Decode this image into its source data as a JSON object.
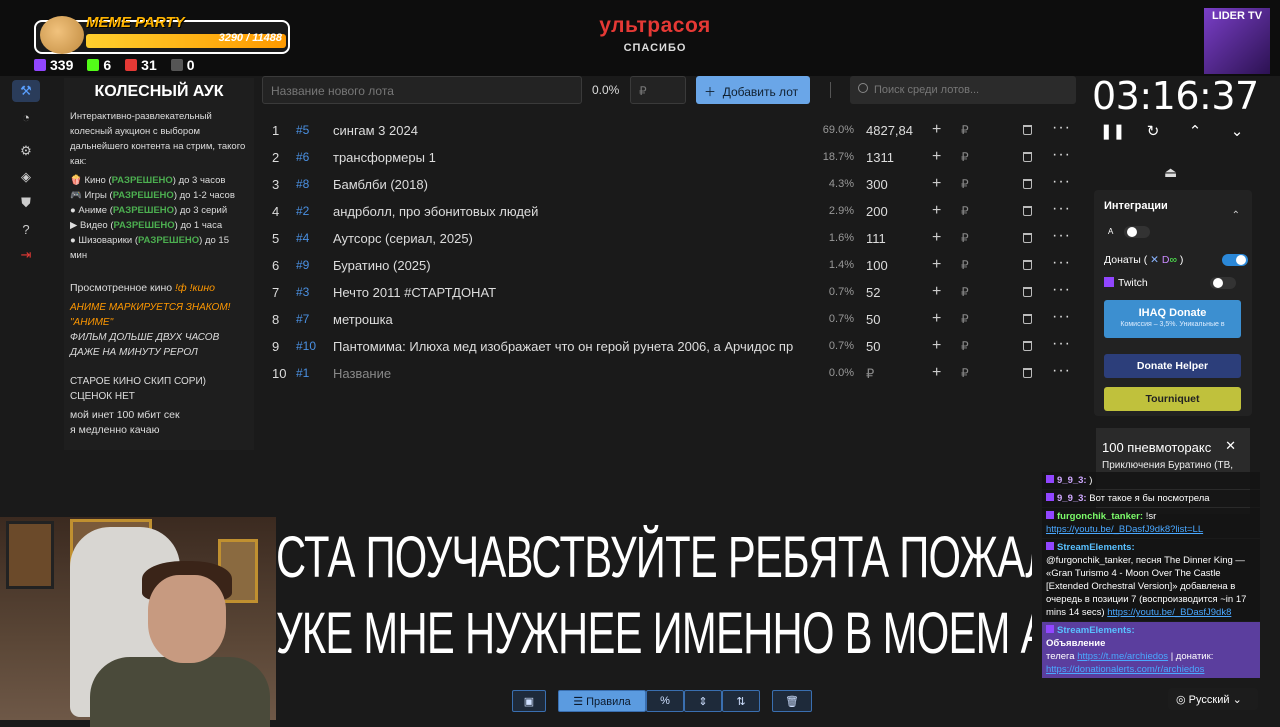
{
  "header": {
    "meme_party": {
      "title": "MEME PARTY",
      "score": "3290 / 11488"
    },
    "stats": [
      {
        "icon": "twitch-icon",
        "value": "339",
        "color": "#9146ff"
      },
      {
        "icon": "kick-icon",
        "value": "6",
        "color": "#53fc18"
      },
      {
        "icon": "vk-live-icon",
        "value": "31",
        "color": "#e53935"
      },
      {
        "icon": "w-icon",
        "value": "0",
        "color": "#ffffff"
      }
    ],
    "brand": {
      "line1": "ультрасоя",
      "line2": "СПАСИБО"
    },
    "channel_badge": "LIDER TV"
  },
  "info_panel": {
    "title": "КОЛЕСНЫЙ АУК",
    "intro": "Интерактивно-развлекательный колесный аукцион с выбором дальнейшего контента на стрим, такого как:",
    "rules": [
      {
        "a": "Кино (",
        "b": "РАЗРЕШЕНО",
        "c": ") до 3 часов"
      },
      {
        "a": "Игры (",
        "b": "РАЗРЕШЕНО",
        "c": ") до 1-2 часов"
      },
      {
        "a": "Аниме (",
        "b": "РАЗРЕШЕНО",
        "c": ") до 3 серий"
      },
      {
        "a": "Видео (",
        "b": "РАЗРЕШЕНО",
        "c": ") до 1 часа"
      },
      {
        "a": "Шизоварики (",
        "b": "РАЗРЕШЕНО",
        "c": ") до 15 мин"
      }
    ],
    "watched": "Просмотренное кино",
    "watched_cmd": "!ф !кино",
    "anime_note": "АНИМЕ МАРКИРУЕТСЯ ЗНАКОМ! \"АНИМЕ\"",
    "film_note": "ФИЛЬМ ДОЛЬШЕ ДВУХ ЧАСОВ ДАЖЕ НА МИНУТУ РЕРОЛ",
    "old_note": "СТАРОЕ КИНО СКИП СОРИ) СЦЕНОК НЕТ",
    "net_note1": "мой инет 100 мбит сек",
    "net_note2": "я медленно качаю"
  },
  "lot_bar": {
    "name_placeholder": "Название нового лота",
    "percent": "0.0%",
    "currency": "₽",
    "add_label": "Добавить лот",
    "search_placeholder": "Поиск среди лотов..."
  },
  "lots": [
    {
      "n": "1",
      "id": "#5",
      "name": "сингам 3 2024",
      "pct": "69.0%",
      "amount": "4827,84"
    },
    {
      "n": "2",
      "id": "#6",
      "name": "трансформеры 1",
      "pct": "18.7%",
      "amount": "1311"
    },
    {
      "n": "3",
      "id": "#8",
      "name": "Бамблби (2018)",
      "pct": "4.3%",
      "amount": "300"
    },
    {
      "n": "4",
      "id": "#2",
      "name": "андрболл, про эбонитовых людей",
      "pct": "2.9%",
      "amount": "200"
    },
    {
      "n": "5",
      "id": "#4",
      "name": "Аутсорс (сериал, 2025)",
      "pct": "1.6%",
      "amount": "111"
    },
    {
      "n": "6",
      "id": "#9",
      "name": "Буратино (2025)",
      "pct": "1.4%",
      "amount": "100"
    },
    {
      "n": "7",
      "id": "#3",
      "name": "Нечто 2011 #СТАРТДОНАТ",
      "pct": "0.7%",
      "amount": "52"
    },
    {
      "n": "8",
      "id": "#7",
      "name": "метрошка",
      "pct": "0.7%",
      "amount": "50"
    },
    {
      "n": "9",
      "id": "#10",
      "name": "Пантомима: Илюха мед изображает что он герой рунета 2006, а Арчидос пр",
      "pct": "0.7%",
      "amount": "50"
    },
    {
      "n": "10",
      "id": "#1",
      "name": "Название",
      "pct": "0.0%",
      "amount": "₽"
    }
  ],
  "lot_currency": "₽",
  "timer": "03:16:37",
  "integrations": {
    "title": "Интеграции",
    "donations_label": "Донаты (",
    "twitch_label": "Twitch",
    "ihaq_label": "IHAQ Donate",
    "ihaq_sub": "Комиссия – 3,5%. Уникальные в",
    "donate_helper": "Donate Helper",
    "tourniquet": "Tourniquet"
  },
  "media": {
    "title": "100 пневмоторакс",
    "subtitle": "Приключения Буратино (ТВ,"
  },
  "chat": [
    {
      "user": "9_9_3:",
      "text": ")"
    },
    {
      "user": "9_9_3:",
      "text": "Вот такое я бы посмотрела"
    },
    {
      "user": "furgonchik_tanker:",
      "text": "!sr",
      "link": "https://youtu.be/_BDasfJ9dk8?list=LL"
    },
    {
      "user": "StreamElements:",
      "text": "@furgonchik_tanker, песня The Dinner King — «Gran Turismo 4 - Moon Over The Castle [Extended Orchestral Version]» добавлена в очередь в позиции 7 (воспроизводится ~in 17 mins 14 secs)",
      "link": "https://youtu.be/_BDasfJ9dk8"
    },
    {
      "user": "StreamElements:",
      "title": "Объявление",
      "text": "телега",
      "link": "https://t.me/archiedos",
      "text2": "| донатик:",
      "link2": "https://donationalerts.com/r/archiedos"
    }
  ],
  "language": "Русский",
  "subtitles": [
    "СТА ПОУЧАВСТВУЙТЕ РЕБЯТА ПОЖАЛУЙС",
    "УКЕ МНЕ НУЖНЕЕ      ИМЕННО В МОЕМ А"
  ],
  "bottom_bar": {
    "rules": "Правила"
  }
}
